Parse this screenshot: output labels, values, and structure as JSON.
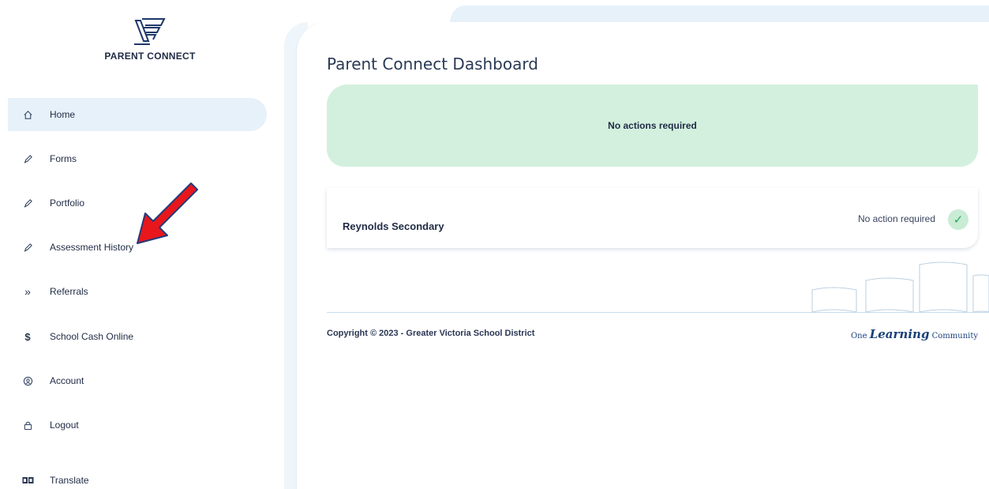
{
  "sidebar": {
    "brand": "PARENT CONNECT",
    "items": [
      {
        "label": "Home",
        "icon": "home-icon",
        "active": true
      },
      {
        "label": "Forms",
        "icon": "pen-icon"
      },
      {
        "label": "Portfolio",
        "icon": "pen-icon"
      },
      {
        "label": "Assessment History",
        "icon": "pen-icon"
      },
      {
        "label": "Referrals",
        "icon": "double-chevron-right-icon"
      },
      {
        "label": "School Cash Online",
        "icon": "dollar-icon"
      },
      {
        "label": "Account",
        "icon": "user-circle-icon"
      },
      {
        "label": "Logout",
        "icon": "lock-icon"
      },
      {
        "label": "Translate",
        "icon": "translate-icon"
      }
    ]
  },
  "main": {
    "title": "Parent Connect Dashboard",
    "alert": "No actions required",
    "school": {
      "name": "Reynolds Secondary",
      "status": "No action required"
    }
  },
  "footer": {
    "copyright": "Copyright © 2023 - Greater Victoria School District",
    "tagline_pre": "One ",
    "tagline_em": "Learning",
    "tagline_post": " Community"
  },
  "colors": {
    "active_nav_bg": "#e6f1fa",
    "alert_bg": "#d3f0de",
    "check_green": "#2ea55a",
    "arrow_red": "#e8171c"
  }
}
